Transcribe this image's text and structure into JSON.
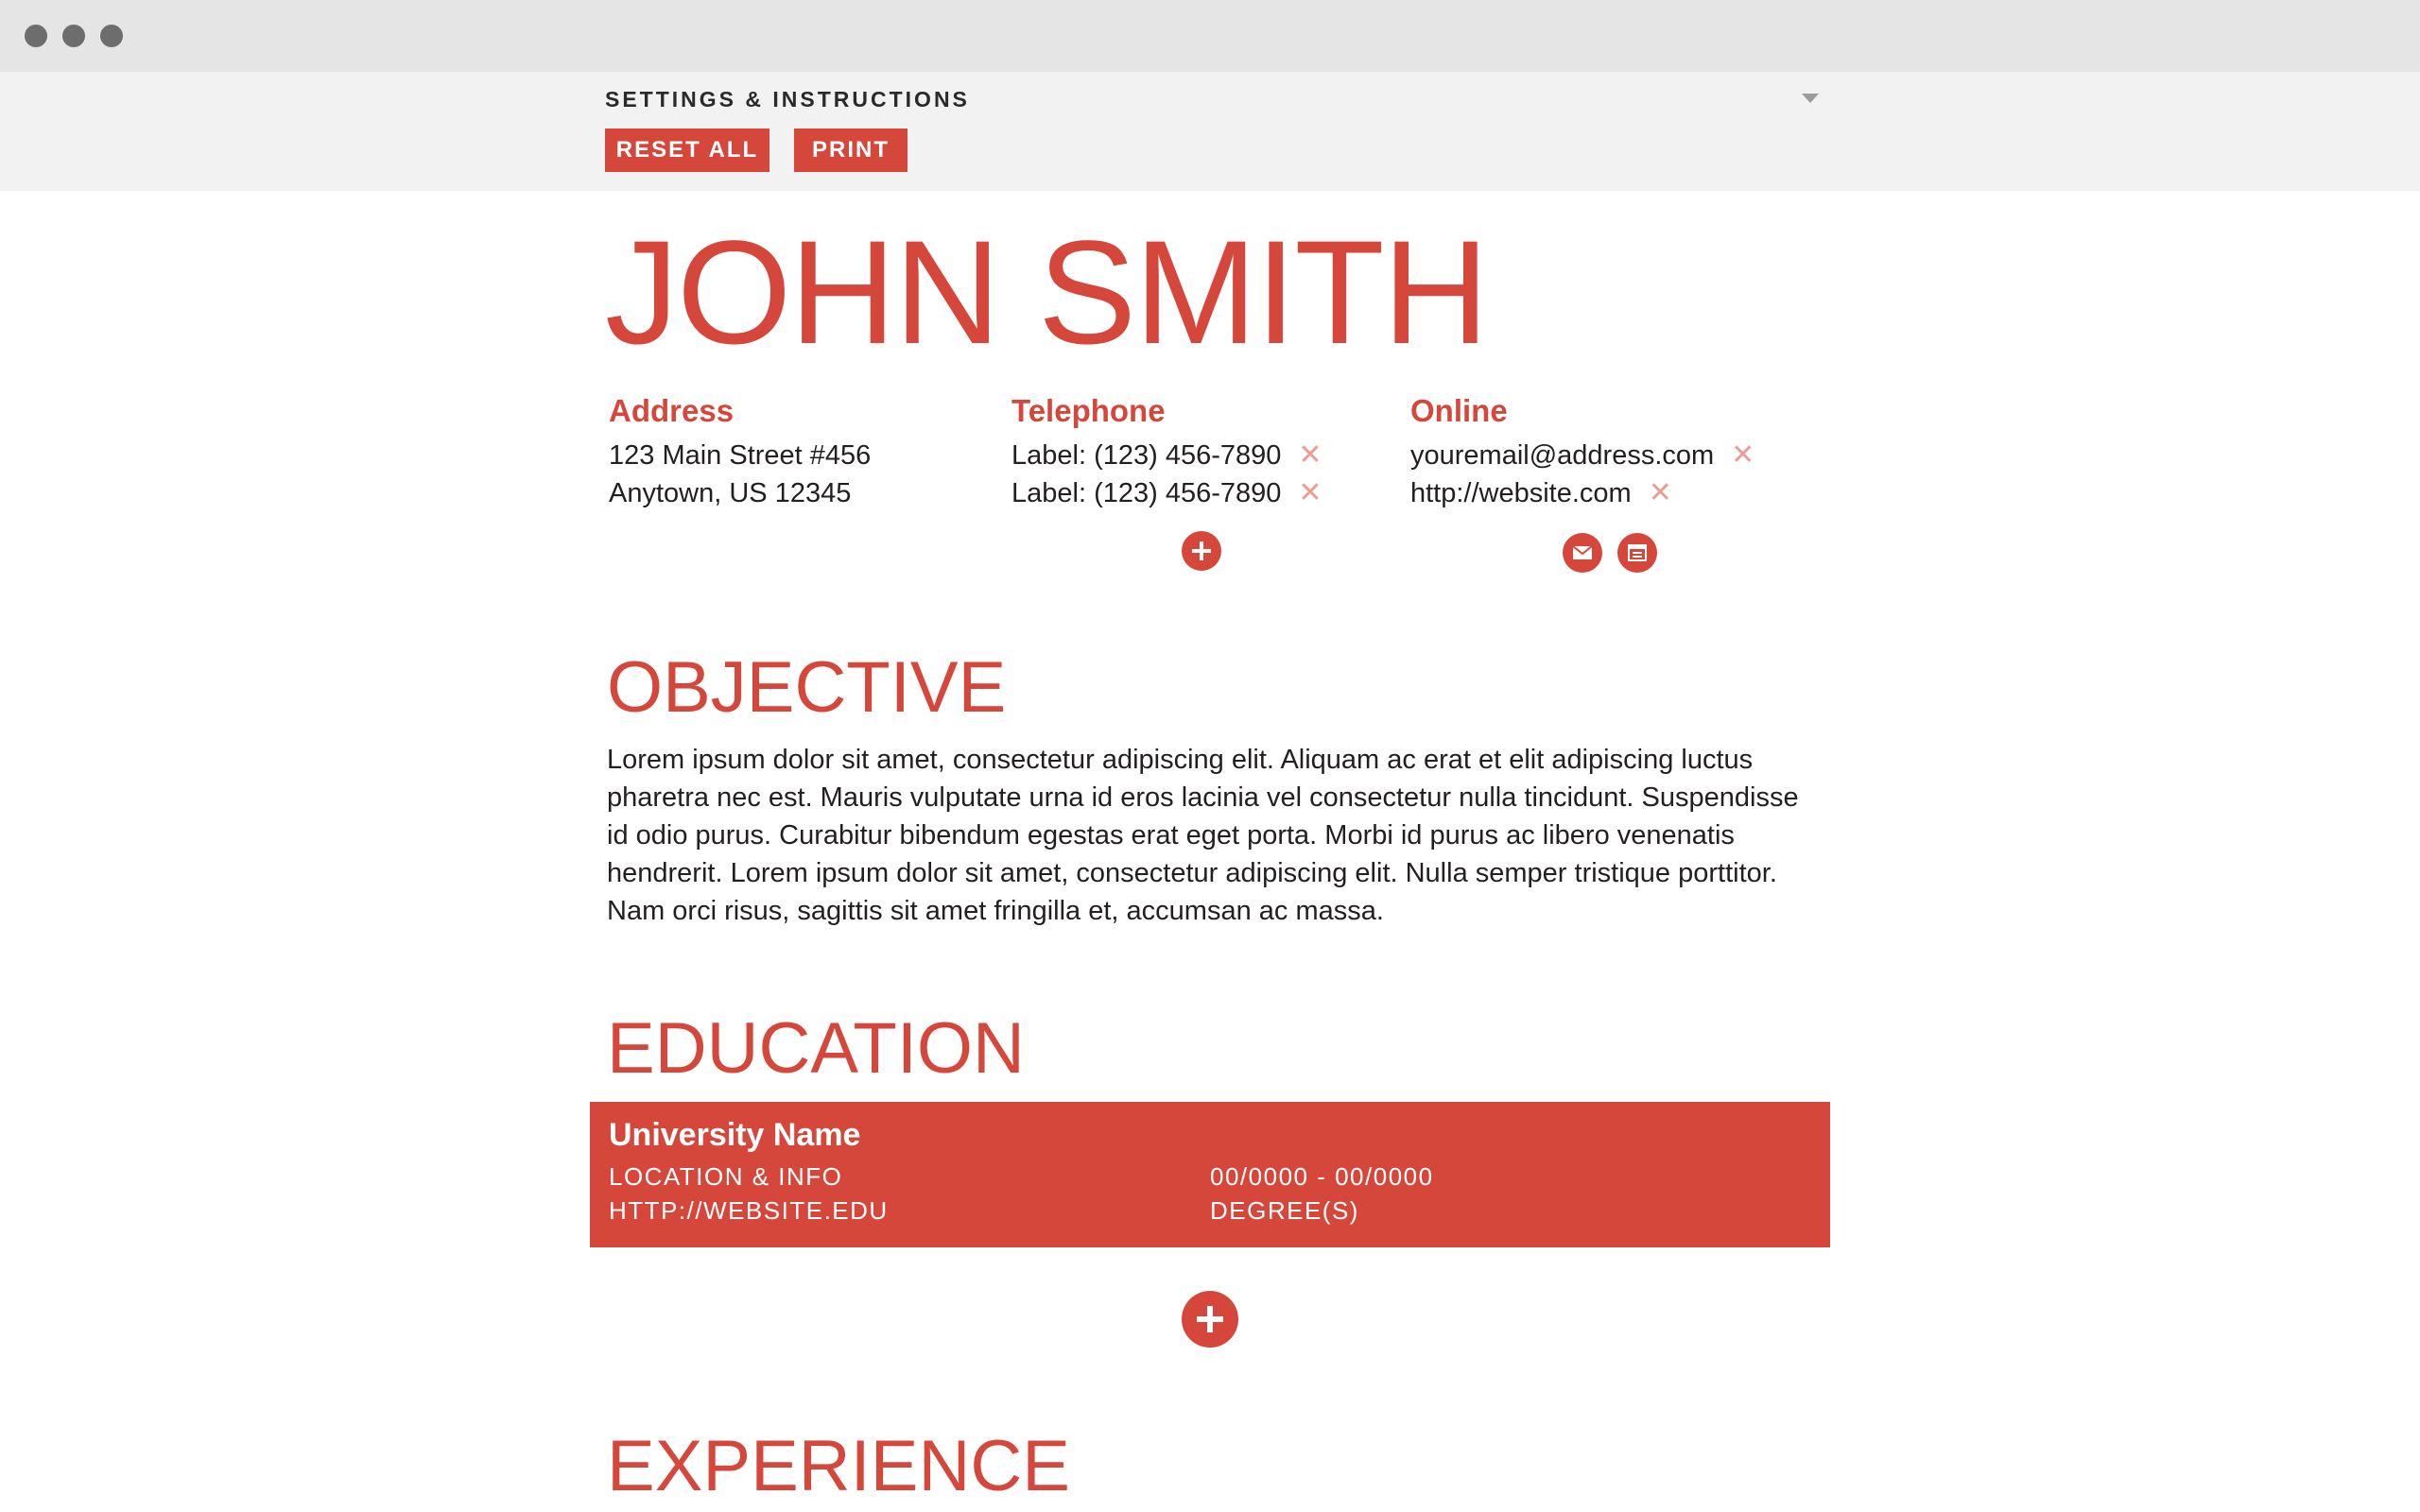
{
  "window": {
    "controls": [
      "close",
      "minimize",
      "zoom"
    ]
  },
  "settings": {
    "title": "SETTINGS & INSTRUCTIONS",
    "reset_label": "RESET ALL",
    "print_label": "PRINT"
  },
  "resume": {
    "name": "JOHN SMITH",
    "address": {
      "heading": "Address",
      "line1": "123 Main Street #456",
      "line2": "Anytown, US 12345"
    },
    "telephone": {
      "heading": "Telephone",
      "phones": [
        "Label: (123) 456-7890",
        "Label: (123) 456-7890"
      ]
    },
    "online": {
      "heading": "Online",
      "email": "youremail@address.com",
      "website": "http://website.com"
    },
    "objective": {
      "heading": "OBJECTIVE",
      "text": "Lorem ipsum dolor sit amet, consectetur adipiscing elit. Aliquam ac erat et elit adipiscing luctus pharetra nec est. Mauris vulputate urna id eros lacinia vel consectetur nulla tincidunt. Suspendisse id odio purus. Curabitur bibendum egestas erat eget porta. Morbi id purus ac libero venenatis hendrerit. Lorem ipsum dolor sit amet, consectetur adipiscing elit. Nulla semper tristique porttitor. Nam orci risus, sagittis sit amet fringilla et, accumsan ac massa."
    },
    "education": {
      "heading": "EDUCATION",
      "entries": [
        {
          "university": "University Name",
          "location": "LOCATION & INFO",
          "website": "HTTP://WEBSITE.EDU",
          "dates": "00/0000 - 00/0000",
          "degree": "DEGREE(S)"
        }
      ]
    },
    "experience": {
      "heading": "EXPERIENCE"
    }
  },
  "icons": {
    "remove": "close-icon",
    "add": "plus-icon",
    "email": "envelope-icon",
    "web": "browser-window-icon",
    "dropdown": "caret-down-icon"
  },
  "colors": {
    "accent": "#d4473a",
    "remove_icon": "#ea9d94",
    "titlebar": "#e5e5e5",
    "settings_bg": "#f2f2f2",
    "text": "#231f20"
  }
}
